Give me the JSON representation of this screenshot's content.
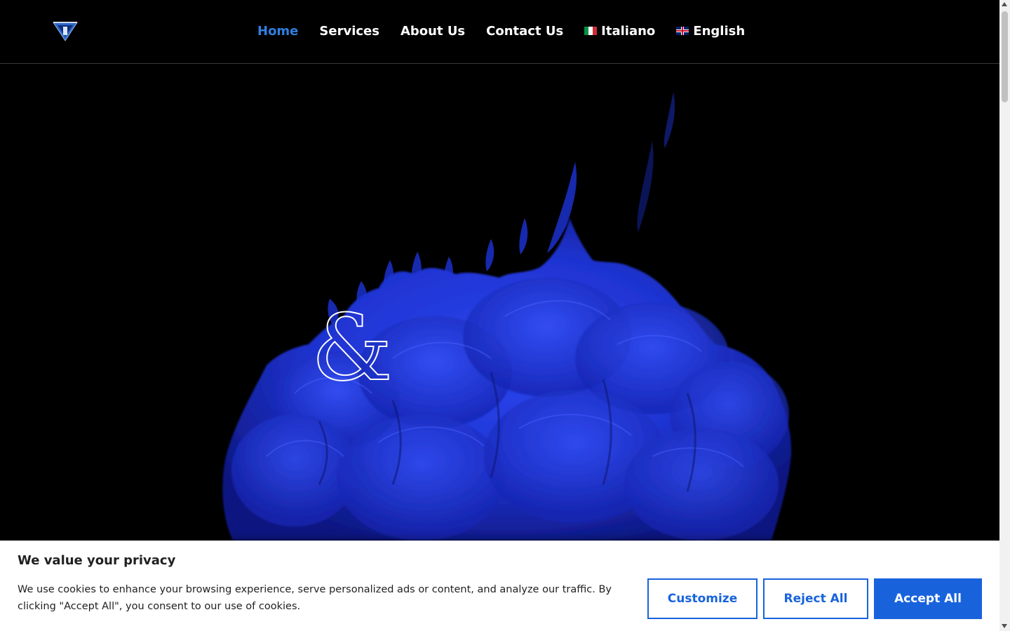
{
  "nav": {
    "items": [
      {
        "label": "Home",
        "active": true
      },
      {
        "label": "Services"
      },
      {
        "label": "About Us"
      },
      {
        "label": "Contact Us"
      }
    ],
    "languages": [
      {
        "label": "Italiano",
        "flag": "italy-flag-icon"
      },
      {
        "label": "English",
        "flag": "uk-flag-icon"
      }
    ]
  },
  "hero": {
    "glyph": "&"
  },
  "cookie": {
    "title": "We value your privacy",
    "text": "We use cookies to enhance your browsing experience, serve personalized ads or content, and analyze our traffic. By clicking \"Accept All\", you consent to our use of cookies.",
    "customize_label": "Customize",
    "reject_label": "Reject All",
    "accept_label": "Accept All"
  },
  "colors": {
    "accent": "#1863dc",
    "nav_active": "#2f7fe0",
    "background": "#000000",
    "ink_blue": "#1f36d6"
  }
}
